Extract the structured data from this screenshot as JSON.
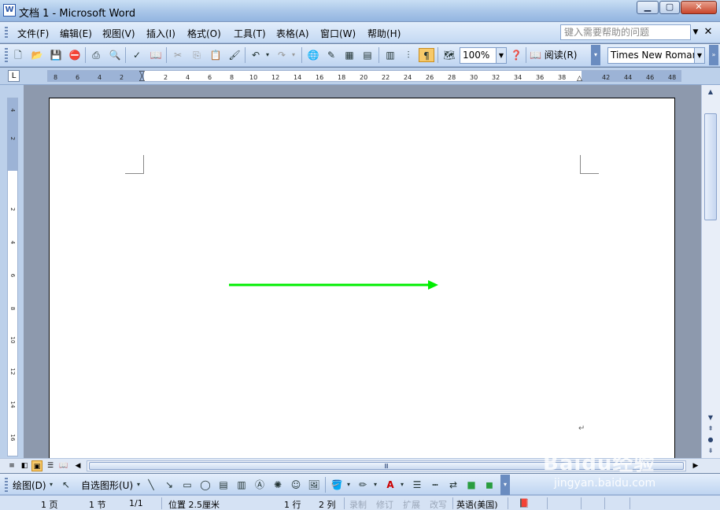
{
  "titlebar": {
    "app_icon": "W",
    "title": "文档 1 - Microsoft Word",
    "min": "▁",
    "max": "▢",
    "close": "✕"
  },
  "menubar": {
    "items": [
      "文件(F)",
      "编辑(E)",
      "视图(V)",
      "插入(I)",
      "格式(O)",
      "工具(T)",
      "表格(A)",
      "窗口(W)",
      "帮助(H)"
    ],
    "help_placeholder": "键入需要帮助的问题",
    "help_dropdown_icon": "chevron-down-icon",
    "close_icon": "close-icon"
  },
  "toolbar": {
    "zoom": "100%",
    "read_label": "阅读(R)",
    "font_name": "Times New Roman",
    "icons": [
      "new-icon",
      "open-icon",
      "save-icon",
      "permission-icon",
      "print-icon",
      "print-preview-icon",
      "spelling-icon",
      "research-icon",
      "cut-icon",
      "copy-icon",
      "paste-icon",
      "format-painter-icon",
      "undo-icon",
      "redo-icon",
      "hyperlink-icon",
      "tables-borders-icon",
      "insert-table-icon",
      "insert-excel-icon",
      "columns-icon",
      "drawing-icon",
      "show-hide-icon",
      "document-map-icon",
      "help-icon",
      "read-icon"
    ]
  },
  "ruler": {
    "tab_selector": "L",
    "labels": [
      "8",
      "6",
      "4",
      "2",
      "2",
      "4",
      "6",
      "8",
      "10",
      "12",
      "14",
      "16",
      "18",
      "20",
      "22",
      "24",
      "26",
      "28",
      "30",
      "32",
      "34",
      "36",
      "38",
      "42",
      "44",
      "46",
      "48"
    ],
    "vlabels": [
      "4",
      "2",
      "2",
      "4",
      "6",
      "8",
      "10",
      "12",
      "14",
      "16"
    ]
  },
  "document": {
    "shape": {
      "type": "arrow",
      "color": "#00ee00"
    },
    "paragraph_mark": "↵"
  },
  "viewbar": {
    "scroll_thumb_label": "Ⅲ"
  },
  "drawbar": {
    "draw_label": "绘图(D)",
    "autoshapes_label": "自选图形(U)"
  },
  "statusbar": {
    "page": "1 页",
    "section": "1 节",
    "page_of": "1/1",
    "position": "位置 2.5厘米",
    "line": "1 行",
    "column": "2 列",
    "rec": "录制",
    "trk": "修订",
    "ext": "扩展",
    "ovr": "改写",
    "language": "英语(美国)"
  },
  "watermark": {
    "main": "Baidu经验",
    "sub": "jingyan.baidu.com"
  },
  "colors": {
    "arrow": "#00ee00",
    "accent": "#f7c96a",
    "title_bg": "#a8c5e8"
  }
}
